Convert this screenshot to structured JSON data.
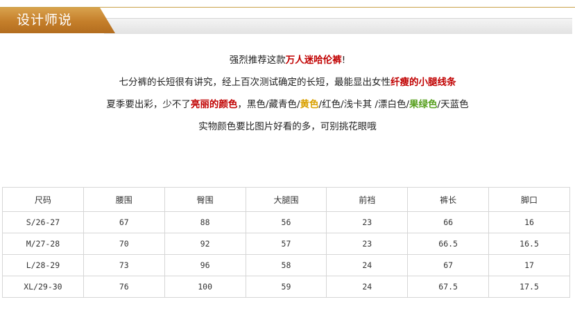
{
  "header": {
    "title": "设计师说"
  },
  "description": {
    "line1": {
      "prefix": "强烈推荐这款",
      "highlight": "万人迷哈伦裤",
      "suffix": "!"
    },
    "line2": {
      "prefix": "七分裤的长短很有讲究，经上百次测试确定的长短，最能显出女性",
      "highlight": "纤瘦的小腿线条"
    },
    "line3": {
      "part1": "夏季要出彩，少不了",
      "highlight_red": "亮丽的颜色",
      "part2": "，黑色/藏青色/",
      "highlight_yellow": "黄色",
      "part3": "/红色/浅卡其 /漂白色/",
      "highlight_green": "果绿色",
      "part4": "/天蓝色"
    },
    "line4": "实物颜色要比图片好看的多，可别挑花眼哦"
  },
  "colors": {
    "accent_gold": "#c9a24a",
    "tab_orange": "#c47e2a",
    "highlight_red": "#c00000",
    "highlight_yellow": "#d9a000",
    "highlight_green": "#58a020"
  },
  "size_table": {
    "headers": [
      "尺码",
      "腰围",
      "臀围",
      "大腿围",
      "前裆",
      "裤长",
      "脚口"
    ],
    "rows": [
      [
        "S/26-27",
        "67",
        "88",
        "56",
        "23",
        "66",
        "16"
      ],
      [
        "M/27-28",
        "70",
        "92",
        "57",
        "23",
        "66.5",
        "16.5"
      ],
      [
        "L/28-29",
        "73",
        "96",
        "58",
        "24",
        "67",
        "17"
      ],
      [
        "XL/29-30",
        "76",
        "100",
        "59",
        "24",
        "67.5",
        "17.5"
      ]
    ]
  }
}
